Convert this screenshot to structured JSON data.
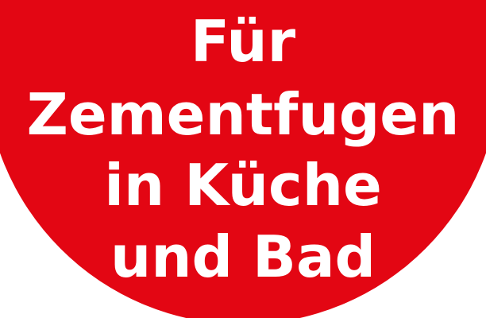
{
  "sticker": {
    "background_color": "#e30613",
    "text_color": "#ffffff",
    "lines": [
      "Für",
      "Zementfugen",
      "in Küche",
      "und Bad"
    ]
  }
}
